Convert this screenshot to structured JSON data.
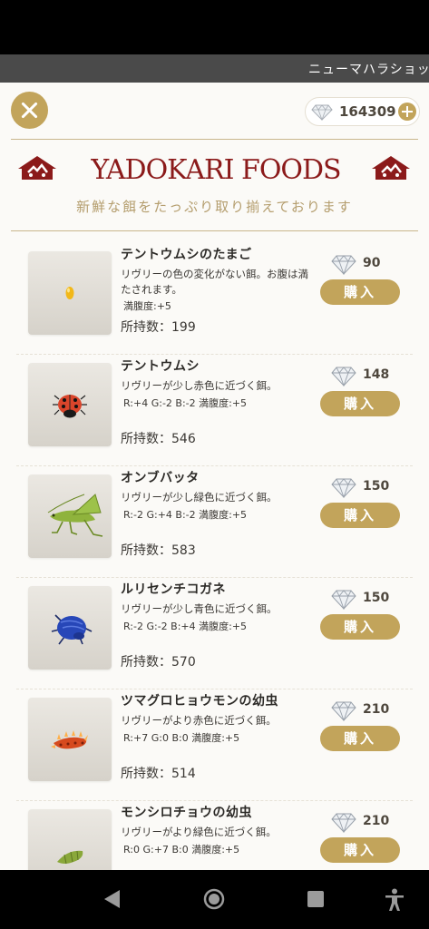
{
  "ticker": {
    "text": "ニューマハラショップ"
  },
  "header": {
    "gem_icon": "diamond-icon",
    "gem_balance": "164309",
    "brand_title": "YADOKARI FOODS",
    "tagline": "新鮮な餌をたっぷり取り揃えております"
  },
  "colors": {
    "accent": "#c2a45b",
    "brand": "#8b1a1a",
    "background": "#fbfaf7"
  },
  "items": [
    {
      "name": "テントウムシのたまご",
      "desc": "リヴリーの色の変化がない餌。お腹は満たされます。",
      "stat": "満腹度:+5",
      "owned_label": "所持数：",
      "owned": "199",
      "price": "90",
      "buy_label": "購入",
      "image": "egg"
    },
    {
      "name": "テントウムシ",
      "desc": "リヴリーが少し赤色に近づく餌。",
      "stat": "R:+4 G:-2 B:-2 満腹度:+5",
      "owned_label": "所持数：",
      "owned": "546",
      "price": "148",
      "buy_label": "購入",
      "image": "ladybug"
    },
    {
      "name": "オンブバッタ",
      "desc": "リヴリーが少し緑色に近づく餌。",
      "stat": "R:-2 G:+4 B:-2 満腹度:+5",
      "owned_label": "所持数：",
      "owned": "583",
      "price": "150",
      "buy_label": "購入",
      "image": "grasshopper"
    },
    {
      "name": "ルリセンチコガネ",
      "desc": "リヴリーが少し青色に近づく餌。",
      "stat": "R:-2 G:-2 B:+4 満腹度:+5",
      "owned_label": "所持数：",
      "owned": "570",
      "price": "150",
      "buy_label": "購入",
      "image": "blue-beetle"
    },
    {
      "name": "ツマグロヒョウモンの幼虫",
      "desc": "リヴリーがより赤色に近づく餌。",
      "stat": "R:+7 G:0 B:0 満腹度:+5",
      "owned_label": "所持数：",
      "owned": "514",
      "price": "210",
      "buy_label": "購入",
      "image": "red-caterpillar"
    },
    {
      "name": "モンシロチョウの幼虫",
      "desc": "リヴリーがより緑色に近づく餌。",
      "stat": "R:0 G:+7 B:0 満腹度:+5",
      "price": "210",
      "buy_label": "購入",
      "image": "green-caterpillar"
    }
  ],
  "navigation": {
    "back": "back-icon",
    "home": "home-icon",
    "recents": "recents-icon",
    "accessibility": "accessibility-icon"
  }
}
